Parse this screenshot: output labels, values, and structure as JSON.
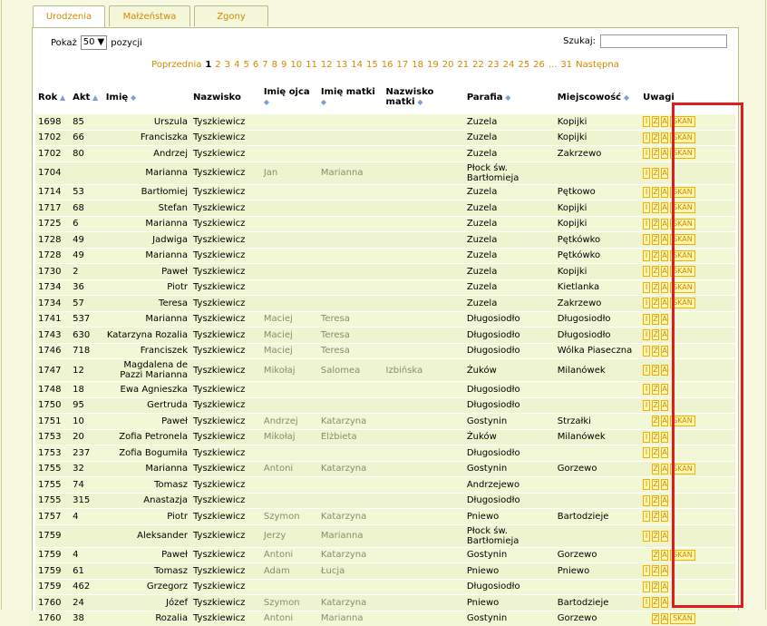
{
  "tabs": [
    "Urodzenia",
    "Małżeństwa",
    "Zgony"
  ],
  "controls": {
    "show_label": "Pokaż",
    "show_value": "50",
    "show_suffix": "pozycji",
    "search_label": "Szukaj:"
  },
  "pager": {
    "prev": "Poprzednia",
    "current": "1",
    "pages": [
      "2",
      "3",
      "4",
      "5",
      "6",
      "7",
      "8",
      "9",
      "10",
      "11",
      "12",
      "13",
      "14",
      "15",
      "16",
      "17",
      "18",
      "19",
      "20",
      "21",
      "22",
      "23",
      "24",
      "25",
      "26"
    ],
    "ellipsis": "...",
    "last": "31",
    "next": "Następna"
  },
  "columns": [
    "Rok",
    "Akt",
    "Imię",
    "Nazwisko",
    "Imię ojca",
    "Imię matki",
    "Nazwisko matki",
    "Parafia",
    "Miejscowość",
    "Uwagi"
  ],
  "rows": [
    {
      "rok": "1698",
      "akt": "85",
      "imie": "Urszula",
      "nazwisko": "Tyszkiewicz",
      "ojciec": "",
      "matka": "",
      "nazw_matki": "",
      "parafia": "Zuzela",
      "miejsc": "Kopijki",
      "uwagi": "IZASKAN"
    },
    {
      "rok": "1702",
      "akt": "66",
      "imie": "Franciszka",
      "nazwisko": "Tyszkiewicz",
      "ojciec": "",
      "matka": "",
      "nazw_matki": "",
      "parafia": "Zuzela",
      "miejsc": "Kopijki",
      "uwagi": "IZASKAN"
    },
    {
      "rok": "1702",
      "akt": "80",
      "imie": "Andrzej",
      "nazwisko": "Tyszkiewicz",
      "ojciec": "",
      "matka": "",
      "nazw_matki": "",
      "parafia": "Zuzela",
      "miejsc": "Zakrzewo",
      "uwagi": "IZASKAN"
    },
    {
      "rok": "1704",
      "akt": "",
      "imie": "Marianna",
      "nazwisko": "Tyszkiewicz",
      "ojciec": "Jan",
      "matka": "Marianna",
      "nazw_matki": "",
      "parafia": "Płock św. Bartłomieja",
      "miejsc": "",
      "uwagi": "IZA",
      "tall": true
    },
    {
      "rok": "1714",
      "akt": "53",
      "imie": "Bartłomiej",
      "nazwisko": "Tyszkiewicz",
      "ojciec": "",
      "matka": "",
      "nazw_matki": "",
      "parafia": "Zuzela",
      "miejsc": "Pętkowo",
      "uwagi": "IZASKAN"
    },
    {
      "rok": "1717",
      "akt": "68",
      "imie": "Stefan",
      "nazwisko": "Tyszkiewicz",
      "ojciec": "",
      "matka": "",
      "nazw_matki": "",
      "parafia": "Zuzela",
      "miejsc": "Kopijki",
      "uwagi": "IZASKAN"
    },
    {
      "rok": "1725",
      "akt": "6",
      "imie": "Marianna",
      "nazwisko": "Tyszkiewicz",
      "ojciec": "",
      "matka": "",
      "nazw_matki": "",
      "parafia": "Zuzela",
      "miejsc": "Kopijki",
      "uwagi": "IZASKAN"
    },
    {
      "rok": "1728",
      "akt": "49",
      "imie": "Jadwiga",
      "nazwisko": "Tyszkiewicz",
      "ojciec": "",
      "matka": "",
      "nazw_matki": "",
      "parafia": "Zuzela",
      "miejsc": "Pętkówko",
      "uwagi": "IZASKAN"
    },
    {
      "rok": "1728",
      "akt": "49",
      "imie": "Marianna",
      "nazwisko": "Tyszkiewicz",
      "ojciec": "",
      "matka": "",
      "nazw_matki": "",
      "parafia": "Zuzela",
      "miejsc": "Pętkówko",
      "uwagi": "IZASKAN"
    },
    {
      "rok": "1730",
      "akt": "2",
      "imie": "Paweł",
      "nazwisko": "Tyszkiewicz",
      "ojciec": "",
      "matka": "",
      "nazw_matki": "",
      "parafia": "Zuzela",
      "miejsc": "Kopijki",
      "uwagi": "IZASKAN"
    },
    {
      "rok": "1734",
      "akt": "36",
      "imie": "Piotr",
      "nazwisko": "Tyszkiewicz",
      "ojciec": "",
      "matka": "",
      "nazw_matki": "",
      "parafia": "Zuzela",
      "miejsc": "Kietlanka",
      "uwagi": "IZASKAN"
    },
    {
      "rok": "1734",
      "akt": "57",
      "imie": "Teresa",
      "nazwisko": "Tyszkiewicz",
      "ojciec": "",
      "matka": "",
      "nazw_matki": "",
      "parafia": "Zuzela",
      "miejsc": "Zakrzewo",
      "uwagi": "IZASKAN"
    },
    {
      "rok": "1741",
      "akt": "537",
      "imie": "Marianna",
      "nazwisko": "Tyszkiewicz",
      "ojciec": "Maciej",
      "matka": "Teresa",
      "nazw_matki": "",
      "parafia": "Długosiodło",
      "miejsc": "Długosiodło",
      "uwagi": "IZA"
    },
    {
      "rok": "1743",
      "akt": "630",
      "imie": "Katarzyna Rozalia",
      "nazwisko": "Tyszkiewicz",
      "ojciec": "Maciej",
      "matka": "Teresa",
      "nazw_matki": "",
      "parafia": "Długosiodło",
      "miejsc": "Długosiodło",
      "uwagi": "IZA"
    },
    {
      "rok": "1746",
      "akt": "718",
      "imie": "Franciszek",
      "nazwisko": "Tyszkiewicz",
      "ojciec": "Maciej",
      "matka": "Teresa",
      "nazw_matki": "",
      "parafia": "Długosiodło",
      "miejsc": "Wólka Piaseczna",
      "uwagi": "IZA"
    },
    {
      "rok": "1747",
      "akt": "12",
      "imie": "Magdalena de Pazzi Marianna",
      "nazwisko": "Tyszkiewicz",
      "ojciec": "Mikołaj",
      "matka": "Salomea",
      "nazw_matki": "Izbińska",
      "parafia": "Żuków",
      "miejsc": "Milanówek",
      "uwagi": "IZA",
      "tall": true
    },
    {
      "rok": "1748",
      "akt": "18",
      "imie": "Ewa Agnieszka",
      "nazwisko": "Tyszkiewicz",
      "ojciec": "",
      "matka": "",
      "nazw_matki": "",
      "parafia": "Długosiodło",
      "miejsc": "",
      "uwagi": "IZA"
    },
    {
      "rok": "1750",
      "akt": "95",
      "imie": "Gertruda",
      "nazwisko": "Tyszkiewicz",
      "ojciec": "",
      "matka": "",
      "nazw_matki": "",
      "parafia": "Długosiodło",
      "miejsc": "",
      "uwagi": "IZA"
    },
    {
      "rok": "1751",
      "akt": "10",
      "imie": "Paweł",
      "nazwisko": "Tyszkiewicz",
      "ojciec": "Andrzej",
      "matka": "Katarzyna",
      "nazw_matki": "",
      "parafia": "Gostynin",
      "miejsc": "Strzałki",
      "uwagi": "ZASKAN"
    },
    {
      "rok": "1753",
      "akt": "20",
      "imie": "Zofia Petronela",
      "nazwisko": "Tyszkiewicz",
      "ojciec": "Mikołaj",
      "matka": "Elżbieta",
      "nazw_matki": "",
      "parafia": "Żuków",
      "miejsc": "Milanówek",
      "uwagi": "IZA"
    },
    {
      "rok": "1753",
      "akt": "237",
      "imie": "Zofia Bogumiła",
      "nazwisko": "Tyszkiewicz",
      "ojciec": "",
      "matka": "",
      "nazw_matki": "",
      "parafia": "Długosiodło",
      "miejsc": "",
      "uwagi": "IZA"
    },
    {
      "rok": "1755",
      "akt": "32",
      "imie": "Marianna",
      "nazwisko": "Tyszkiewicz",
      "ojciec": "Antoni",
      "matka": "Katarzyna",
      "nazw_matki": "",
      "parafia": "Gostynin",
      "miejsc": "Gorzewo",
      "uwagi": "ZASKAN"
    },
    {
      "rok": "1755",
      "akt": "74",
      "imie": "Tomasz",
      "nazwisko": "Tyszkiewicz",
      "ojciec": "",
      "matka": "",
      "nazw_matki": "",
      "parafia": "Andrzejewo",
      "miejsc": "",
      "uwagi": "IZA"
    },
    {
      "rok": "1755",
      "akt": "315",
      "imie": "Anastazja",
      "nazwisko": "Tyszkiewicz",
      "ojciec": "",
      "matka": "",
      "nazw_matki": "",
      "parafia": "Długosiodło",
      "miejsc": "",
      "uwagi": "IZA"
    },
    {
      "rok": "1757",
      "akt": "4",
      "imie": "Piotr",
      "nazwisko": "Tyszkiewicz",
      "ojciec": "Szymon",
      "matka": "Katarzyna",
      "nazw_matki": "",
      "parafia": "Pniewo",
      "miejsc": "Bartodzieje",
      "uwagi": "IZA"
    },
    {
      "rok": "1759",
      "akt": "",
      "imie": "Aleksander",
      "nazwisko": "Tyszkiewicz",
      "ojciec": "Jerzy",
      "matka": "Marianna",
      "nazw_matki": "",
      "parafia": "Płock św. Bartłomieja",
      "miejsc": "",
      "uwagi": "IZA",
      "tall": true
    },
    {
      "rok": "1759",
      "akt": "4",
      "imie": "Paweł",
      "nazwisko": "Tyszkiewicz",
      "ojciec": "Antoni",
      "matka": "Katarzyna",
      "nazw_matki": "",
      "parafia": "Gostynin",
      "miejsc": "Gorzewo",
      "uwagi": "ZASKAN"
    },
    {
      "rok": "1759",
      "akt": "61",
      "imie": "Tomasz",
      "nazwisko": "Tyszkiewicz",
      "ojciec": "Adam",
      "matka": "Łucja",
      "nazw_matki": "",
      "parafia": "Pniewo",
      "miejsc": "Pniewo",
      "uwagi": "IZA"
    },
    {
      "rok": "1759",
      "akt": "462",
      "imie": "Grzegorz",
      "nazwisko": "Tyszkiewicz",
      "ojciec": "",
      "matka": "",
      "nazw_matki": "",
      "parafia": "Długosiodło",
      "miejsc": "",
      "uwagi": "IZA"
    },
    {
      "rok": "1760",
      "akt": "24",
      "imie": "Józef",
      "nazwisko": "Tyszkiewicz",
      "ojciec": "Szymon",
      "matka": "Katarzyna",
      "nazw_matki": "",
      "parafia": "Pniewo",
      "miejsc": "Bartodzieje",
      "uwagi": "IZA"
    },
    {
      "rok": "1760",
      "akt": "38",
      "imie": "Rozalia",
      "nazwisko": "Tyszkiewicz",
      "ojciec": "Antoni",
      "matka": "Marianna",
      "nazw_matki": "",
      "parafia": "Gostynin",
      "miejsc": "Gorzewo",
      "uwagi": "ZASKAN"
    }
  ],
  "icons": {
    "I": "I",
    "Z": "Z",
    "A": "A",
    "SKAN": "SKAN"
  },
  "colors": {
    "accent": "#d08a00",
    "row_bg": "#f2f8d6",
    "highlight": "#e21c1c"
  }
}
